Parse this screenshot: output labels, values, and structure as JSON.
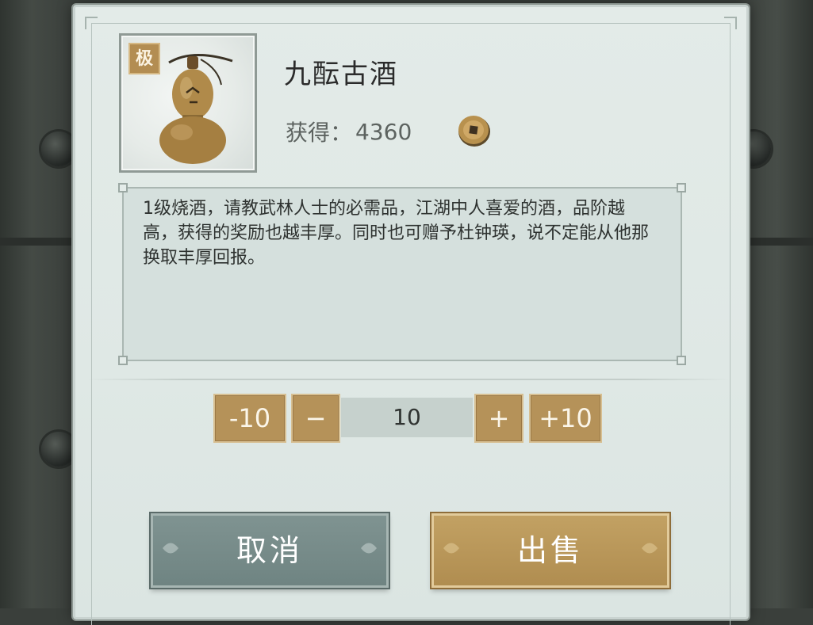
{
  "item": {
    "name": "九酝古酒",
    "quality_badge": "极",
    "icon": "wine-gourd-icon",
    "reward_label": "获得：",
    "reward_value": "4360",
    "currency_icon": "copper-coin-icon",
    "description": "1级烧酒，请教武林人士的必需品，江湖中人喜爱的酒，品阶越高，获得的奖励也越丰厚。同时也可赠予杜钟瑛，说不定能从他那换取丰厚回报。"
  },
  "quantity": {
    "minus10_label": "-10",
    "minus_label": "−",
    "value": "10",
    "plus_label": "+",
    "plus10_label": "+10"
  },
  "actions": {
    "cancel_label": "取消",
    "sell_label": "出售"
  },
  "colors": {
    "panel_bg": "#dfe8e5",
    "gold_button": "#b59259",
    "cancel_button": "#778b89"
  }
}
